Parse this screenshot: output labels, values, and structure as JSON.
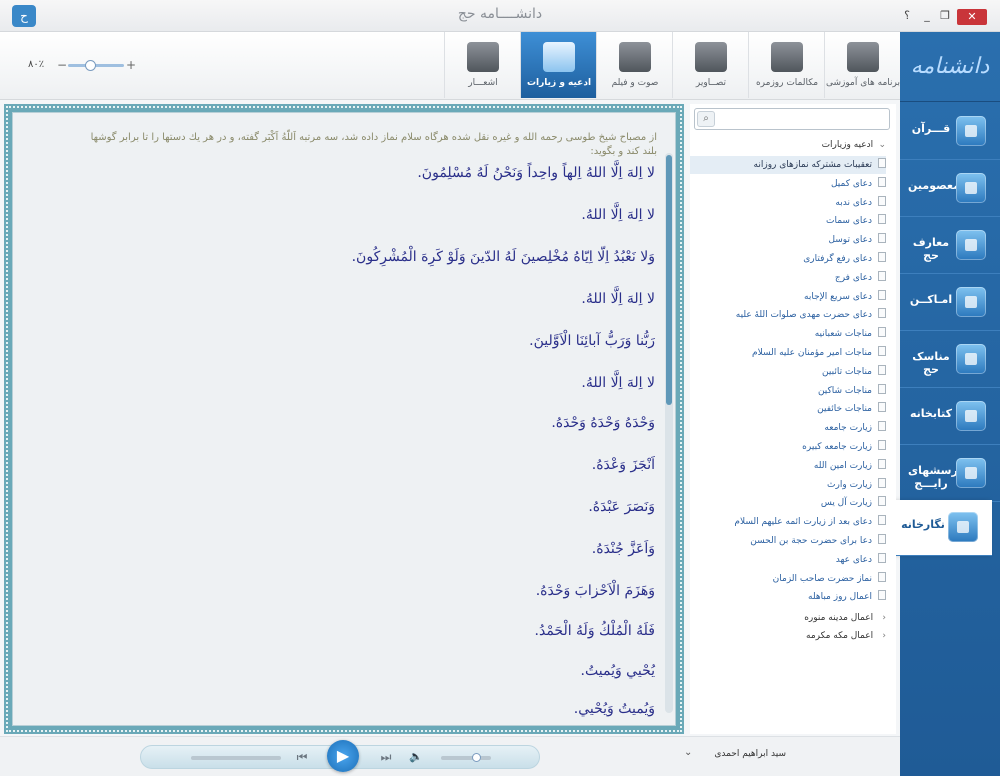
{
  "window": {
    "title": "دانشــــامه حج",
    "help": "؟",
    "minimize": "_",
    "restore": "❐",
    "close": "✕",
    "logo_glyph": "ح"
  },
  "sidebar": {
    "logo_text": "دانشنامه",
    "items": [
      {
        "label": "قـــرآن",
        "icon": "quran-icon"
      },
      {
        "label": "معصومين",
        "icon": "shrine-icon"
      },
      {
        "label": "معارف حج",
        "icon": "kaaba-icon"
      },
      {
        "label": "امـاکــن",
        "icon": "mosque-icon"
      },
      {
        "label": "مناسک حج",
        "icon": "pilgrim-icon"
      },
      {
        "label": "کتابخانه",
        "icon": "library-icon"
      },
      {
        "label": "پرسشهای رايـــج",
        "icon": "question-icon"
      },
      {
        "label": "نگارخانه",
        "icon": "gallery-icon"
      }
    ],
    "active_index": 7
  },
  "toolbar": {
    "tabs": [
      {
        "label": "برنامه های آموزشی",
        "icon": "book-icon"
      },
      {
        "label": "مکالمات روزمره",
        "icon": "people-icon"
      },
      {
        "label": "تصــاویر",
        "icon": "camera-icon"
      },
      {
        "label": "صوت و فیلم",
        "icon": "film-icon"
      },
      {
        "label": "ادعیه و زیارات",
        "icon": "prayer-icon"
      },
      {
        "label": "اشعـــار",
        "icon": "quill-icon"
      }
    ],
    "active_index": 4,
    "zoom_label": "۸۰٪",
    "zoom_minus": "−",
    "zoom_plus": "+",
    "zoom_level": 0.4
  },
  "reader": {
    "intro": "از مصباح شيخ طوسی رحمه الله و غيره نقل شده هرگاه سلام نماز داده شد، سه مرتبه اَللّهُ اَكْبَر گفته، و در هر يك دستها را تا برابر گوشها بلند كند و بگويد:",
    "verses": [
      "لا اِلهَ اِلَّا اللهُ اِلهاً واحِداً وَنَحْنُ لَهُ مُسْلِمُونَ.",
      "لا اِلهَ اِلَّا اللهُ.",
      "وَلا نَعْبُدُ اِلّا اِيّاهُ مُخْلِصينَ لَهُ الدّينَ وَلَوْ كَرِهَ الْمُشْرِكُونَ.",
      "لا اِلهَ اِلَّا اللهُ.",
      "رَبُّنا وَرَبُّ آبائِنَا الْاَوَّلينَ.",
      "لا اِلهَ اِلَّا اللهُ.",
      "وَحْدَهُ وَحْدَهُ وَحْدَهُ.",
      "اَنْجَزَ وَعْدَهُ.",
      "وَنَصَرَ عَبْدَهُ.",
      "وَاَعَزَّ جُنْدَهُ.",
      "وَهَزَمَ الْاَحْزابَ وَحْدَهُ.",
      "فَلَهُ الْمُلْكُ وَلَهُ الْحَمْدُ.",
      "يُحْيي وَيُميتُ.",
      "وَيُميتُ وَيُحْيي."
    ],
    "scroll_fraction": 0.0
  },
  "tree": {
    "search_icon": "⌕",
    "root": {
      "label": "ادعیه وزیارات",
      "arrow": "⌄"
    },
    "leaves": [
      "تعقيبات مشترکه نمازهای روزانه",
      "دعای کمیل",
      "دعای ندبه",
      "دعای سمات",
      "دعای توسل",
      "دعای رفع گرفتاری",
      "دعای فرج",
      "دعای سریع الإجابه",
      "دعای حضرت مهدی صلوات اللهٔ علیه",
      "مناجات شعبانیه",
      "مناجات امیر مؤمنان علیه السلام",
      "مناجات تائبین",
      "مناجات شاکین",
      "مناجات خائفین",
      "زیارت جامعه",
      "زیارت جامعه کبیره",
      "زیارت امین الله",
      "زیارت وارث",
      "زیارت آل یس",
      "دعای بعد از زیارت ائمه علیهم السلام",
      "دعا برای حضرت حجة بن الحسن",
      "دعای عهد",
      "نماز حضرت صاحب الزمان",
      "اعمال روز مباهله"
    ],
    "selected_index": 0,
    "collapsed": [
      {
        "label": "اعمال مدینه منوره",
        "arrow": "‹"
      },
      {
        "label": "اعمال مکه مکرمه",
        "arrow": "‹"
      }
    ]
  },
  "player": {
    "prev": "⏮",
    "play": "▶",
    "next": "⏭",
    "volume": "🔈",
    "volume_level": 0.7,
    "reciter": "سید ابراهیم احمدی",
    "reciter_arrow": "⌄"
  }
}
